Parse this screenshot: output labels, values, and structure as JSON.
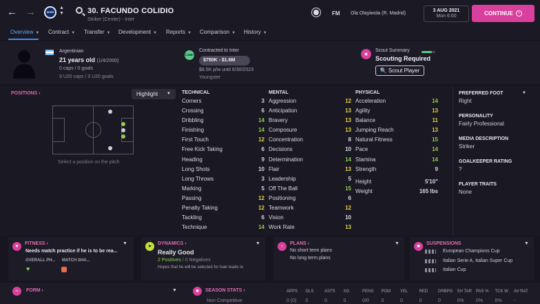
{
  "header": {
    "title": "30. FACUNDO COLIDIO",
    "subtitle": "Striker (Center) - Inter",
    "club_badge": "INTER",
    "game_logo": "FM",
    "manager": "Ola Olayiwola (R. Madrid)",
    "date": "3 AUG 2021",
    "time": "Mon 6:00",
    "continue_label": "CONTINUE",
    "icons": [
      "back-arrow-icon",
      "forward-arrow-icon",
      "search-icon",
      "football-icon",
      "continue-circle-icon"
    ]
  },
  "tabs": [
    {
      "label": "Overview"
    },
    {
      "label": "Contract"
    },
    {
      "label": "Transfer"
    },
    {
      "label": "Development"
    },
    {
      "label": "Reports"
    },
    {
      "label": "Comparison"
    },
    {
      "label": "History"
    }
  ],
  "profile": {
    "nationality": "Argentinian",
    "age": "21 years old",
    "dob": "(1/4/2000)",
    "caps": "0 caps / 0 goals",
    "youth_caps": "9 U20 caps / 3 U20 goals",
    "loan_badge": "Loan",
    "contract_label": "Contracted to Inter",
    "value": "$750K - $1.6M",
    "wage": "$8.5K p/w until 6/30/2023",
    "status": "Youngster",
    "scout_label": "Scout Summary",
    "scout_knowledge": 0.75,
    "scout_status": "Scouting Required",
    "scout_button": "Scout Player"
  },
  "positions": {
    "label": "POSITIONS",
    "highlight_label": "Highlight",
    "hint": "Select a position on the pitch"
  },
  "attributes": {
    "technical": {
      "header": "TECHNICAL",
      "rows": [
        {
          "name": "Corners",
          "value": "3"
        },
        {
          "name": "Crossing",
          "value": "6"
        },
        {
          "name": "Dribbling",
          "value": "14"
        },
        {
          "name": "Finishing",
          "value": "14"
        },
        {
          "name": "First Touch",
          "value": "12"
        },
        {
          "name": "Free Kick Taking",
          "value": "6"
        },
        {
          "name": "Heading",
          "value": "9"
        },
        {
          "name": "Long Shots",
          "value": "10"
        },
        {
          "name": "Long Throws",
          "value": "3"
        },
        {
          "name": "Marking",
          "value": "5"
        },
        {
          "name": "Passing",
          "value": "12"
        },
        {
          "name": "Penalty Taking",
          "value": "12"
        },
        {
          "name": "Tackling",
          "value": "6"
        },
        {
          "name": "Technique",
          "value": "14"
        }
      ]
    },
    "mental": {
      "header": "MENTAL",
      "rows": [
        {
          "name": "Aggression",
          "value": "12"
        },
        {
          "name": "Anticipation",
          "value": "13"
        },
        {
          "name": "Bravery",
          "value": "13"
        },
        {
          "name": "Composure",
          "value": "13"
        },
        {
          "name": "Concentration",
          "value": "8"
        },
        {
          "name": "Decisions",
          "value": "10"
        },
        {
          "name": "Determination",
          "value": "14"
        },
        {
          "name": "Flair",
          "value": "13"
        },
        {
          "name": "Leadership",
          "value": "5"
        },
        {
          "name": "Off The Ball",
          "value": "15"
        },
        {
          "name": "Positioning",
          "value": "6"
        },
        {
          "name": "Teamwork",
          "value": "12"
        },
        {
          "name": "Vision",
          "value": "10"
        },
        {
          "name": "Work Rate",
          "value": "13"
        }
      ]
    },
    "physical": {
      "header": "PHYSICAL",
      "rows": [
        {
          "name": "Acceleration",
          "value": "14"
        },
        {
          "name": "Agility",
          "value": "13"
        },
        {
          "name": "Balance",
          "value": "11"
        },
        {
          "name": "Jumping Reach",
          "value": "13"
        },
        {
          "name": "Natural Fitness",
          "value": "15"
        },
        {
          "name": "Pace",
          "value": "14"
        },
        {
          "name": "Stamina",
          "value": "14"
        },
        {
          "name": "Strength",
          "value": "9"
        }
      ],
      "height_label": "Height",
      "height": "5'10\"",
      "weight_label": "Weight",
      "weight": "165 lbs"
    }
  },
  "side": {
    "preferred_foot_label": "PREFERRED FOOT",
    "preferred_foot": "Right",
    "personality_label": "PERSONALITY",
    "personality": "Fairly Professional",
    "media_label": "MEDIA DESCRIPTION",
    "media": "Striker",
    "gk_label": "GOALKEEPER RATING",
    "gk": "?",
    "traits_label": "PLAYER TRAITS",
    "traits": "None"
  },
  "cards": {
    "fitness": {
      "title": "FITNESS",
      "line1": "Needs match practice if he is to be rea...",
      "col1": "OVERALL PH...",
      "col2": "MATCH SHA..."
    },
    "dynamics": {
      "title": "DYNAMICS",
      "line1": "Really Good",
      "positives": "2 Positives",
      "negatives": "0 Negatives",
      "line3": "Hopes that he will be selected for loan leads to"
    },
    "plans": {
      "title": "PLANS",
      "line1": "No short term plans",
      "line2": "No long term plans"
    },
    "suspensions": {
      "title": "SUSPENSIONS",
      "items": [
        "European Champions Cup",
        "Italian Serie A, Italian Super Cup",
        "Italian Cup"
      ]
    }
  },
  "bottom": {
    "form_label": "FORM",
    "season_label": "SEASON STATS",
    "competition": "Non Competitive",
    "columns": [
      "APPS",
      "GLS",
      "ASTS",
      "XG",
      "PENS",
      "POM",
      "YEL",
      "RED",
      "DRBPG",
      "SH TAR",
      "PAS %",
      "TCK W",
      "AV RAT"
    ],
    "values": [
      "0 (0)",
      "0",
      "0",
      "0",
      "0/0",
      "0",
      "0",
      "0",
      "0",
      "0%",
      "0%",
      "0%",
      "-"
    ]
  },
  "colors": {
    "accent": "#d93f9c",
    "high_value": "#8fd14f",
    "mid_value": "#e8d24a",
    "link": "#5ea9ff"
  }
}
